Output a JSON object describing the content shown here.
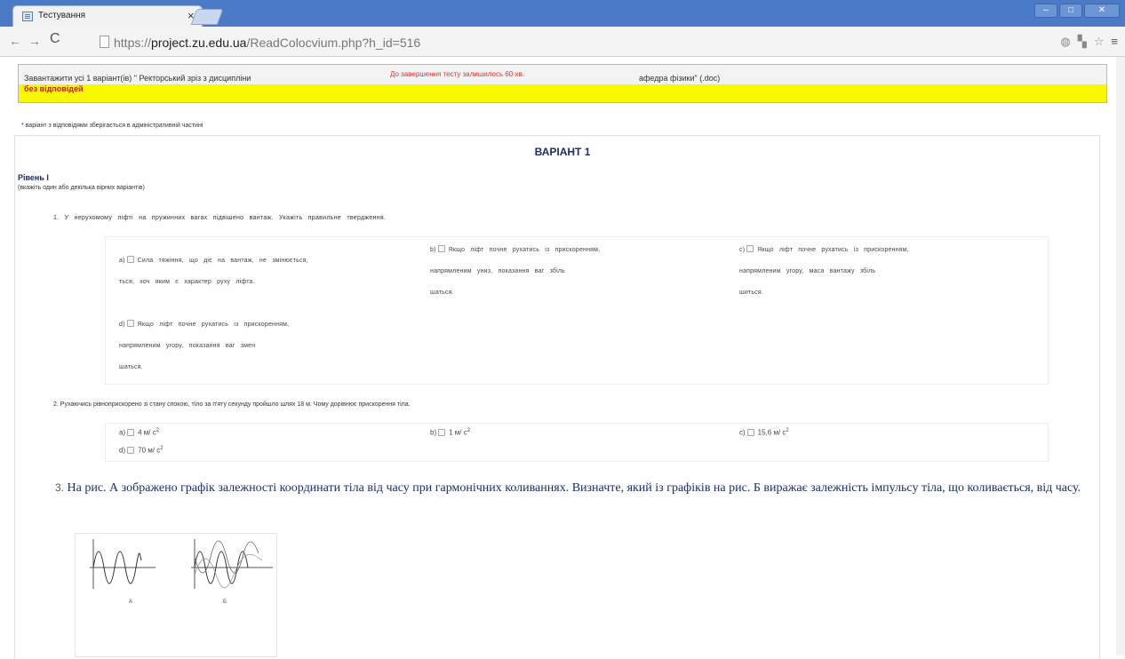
{
  "browser": {
    "tab_title": "Тестування",
    "tab_close": "×",
    "url_scheme": "https://",
    "url_host": "project.zu.edu.ua",
    "url_path": "/ReadColocvium.php?h_id=516"
  },
  "infobox": {
    "download_text_part1": "Завантажити усі 1 варіант(ів) \" Ректорський зріз з дисципліни",
    "timer_text": "До завершення тесту залишилось 60 хв.",
    "download_text_part2": "афедра фізики\" (.doc)",
    "no_answers_text": "без відповідей"
  },
  "note": "* варіант з відповідями зберігається в адміністративній частині",
  "variant_title": "ВАРІАНТ 1",
  "level_title": "Рівень І",
  "level_note": "(вкажіть один або декілька вірних варіантів)",
  "q1": {
    "text": "1. У нерухомому ліфті на пружинних вагах підвішено вантаж. Укажіть правильне твердження.",
    "a_l1": "a)",
    "a_t1": "Сила тяжіння, що діє на вантаж, не змінюється,",
    "a_t2": "ться, хоч яким є характер руху ліфта.",
    "b_l1": "b)",
    "b_t1": "Якщо ліфт почне рухатись із прискоренням,",
    "b_t2": "напрямленим униз, показання ваг збіль",
    "b_t3": "шаться.",
    "c_l1": "c)",
    "c_t1": "Якщо ліфт почне рухатись із прискоренням,",
    "c_t2": "напрямленим угору, маса вантажу збіль",
    "c_t3": "шиться.",
    "d_l1": "d)",
    "d_t1": "Якщо ліфт почне рухатись із прискоренням,",
    "d_t2": "напрямленим угору, показання ваг змен",
    "d_t3": "шаться."
  },
  "q2": {
    "text": "2. Рухаючись рівноприскорено зі стану спокою, тіло за п'яту секунду пройшло шлях 18 м. Чому дорівнює прискорення тіла.",
    "a_label": "a)",
    "a_value": "4 м/ с",
    "a_sup": "2",
    "b_label": "b)",
    "b_value": "1 м/ с",
    "b_sup": "2",
    "c_label": "c)",
    "c_value": "15,6 м/ с",
    "c_sup": "2",
    "d_label": "d)",
    "d_value": "70 м/ с",
    "d_sup": "2"
  },
  "q3": {
    "number": "3.",
    "text": "На рис. А зображено графік залежності координати тіла від часу при гармонічних коливаннях. Визначте, який із графіків на рис. Б виражає залежність імпульсу тіла, що коливається, від часу."
  },
  "figure": {
    "label_a": "А",
    "label_b": "Б"
  }
}
